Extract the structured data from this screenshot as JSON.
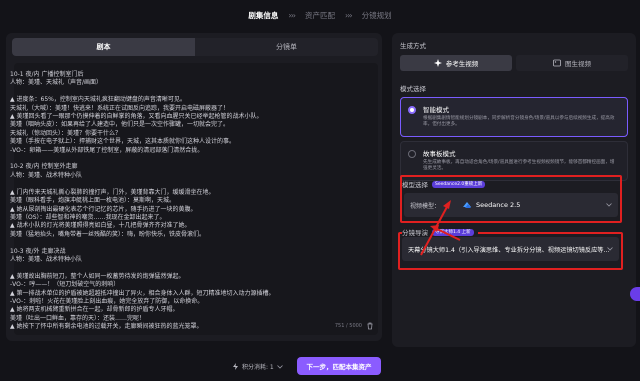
{
  "steps": [
    {
      "label": "剧集信息",
      "state": "active"
    },
    {
      "label": "资产匹配",
      "state": "inactive"
    },
    {
      "label": "分镜规划",
      "state": "inactive"
    }
  ],
  "left": {
    "tabs": [
      "剧本",
      "分镜单"
    ],
    "script_text": "10-1 夜/内 广播控制室门后\n人物：美瑾、天城礼（声音/画面）\n\n▲ 进度条：65%，控制室内天城礼疯狂翻动键盘的声音清晰可见。\n天城礼（大喊）：美瑾！快逃来！系统正在试图反向追踪，我要开启电磁屏蔽器了！\n▲ 美瑾回头看了一眼那个仍摸伸着的自鲜掌的角落，又看向血腥只关已经举起枪管的战术小队。\n美瑾（咽呐头皮）：如果再给了人建造中，他们只是一次空作骤罐，一切就会完了。\n天城礼（惊动回头）：美瑾？你要干什么？\n美瑾（手按在电子狱上）：捍捕财这个世界，天城，这其本质就你们这种人设计的事。\n-VO-：卵箱——美瑾从外部铁尾了控制室，屏蔽的清冠部落门清然合拢。\n\n10-2 夜/内 控制室外走廊\n人物：美瑾、战术特种小队\n\n▲ 门内传来天城礼撕心裂肺的撞打声，门外，美瑾背靠大门，缓缓滑坐在地。\n美瑾（眼科看手，炮旗冲艇桃上面一枚电池）：莫斯啊，天城。\n▲ 她从尿剖掏出最硬化表芯个行记忆的芯片，随手扔进了一块的黄腹。\n美瑾（OS）：却些智和神的嘲货……我现在金卸出起来了。\n▲ 战术小队的灯光将美瑾照得亮如白昼，十几把骨弹齐齐对准了她。\n美瑾（猛地抬头，嘴角带着一丝残酷的笑）：嗨，盼你快乐，铁皮骨滚们。\n\n10-3 夜/外 走廊决战\n人物：美瑾、战术特种小队\n\n▲ 美瑾故出胸前短刀，整个人如同一枚蓄势待发的炮弹猛然弹起。\n-VO-：哼——！（短刀划破空气的刺响）\n▲ 第一排战术单位的护盾被她超越抵冲撞出了异火，相合身体入人群，短刀精准地切入动力源插槽。\n-VO-：刺啦！火花在美瑾脸上刻出血痕，她完全放弃了防御，以命换命。\n▲ 她将两支机械臂重新拼合在一起，却骨新郎的护盾专人牙帽。\n美瑾（吐出一口鲜血，靠存的天）：还装……完呢！\n▲ 她按下了怀中所有剩余电池的过载开关，走廊瞬间被狂热的蓝光笼罩。",
    "char_count": "751 / 5000"
  },
  "right": {
    "gen_section_title": "生成方式",
    "gen_buttons": [
      "参考生视频",
      "图生视频"
    ],
    "mode_section_title": "模式选择",
    "modes": [
      {
        "title": "智能模式",
        "desc": "根据剧集剧情智能规划分镜剧本，同步解析音分镜身色/场景/道具以参与后续视频生成，提高效率，但付出更多。",
        "selected": true
      },
      {
        "title": "故事板模式",
        "desc": "先生成故事板，再自动适合角色/场景/道具图进行参考生视频视频镜节，能够首都精控画面，增强更灵活。",
        "selected": false
      }
    ],
    "model_section_title": "模型选择",
    "model_badge": "Seedance2.0重磅上新",
    "model_prefix": "视频模型：",
    "model_value": "Seedance 2.5",
    "director_section_title": "分镜导演",
    "director_badge": "导演大师1.4 上新",
    "director_value": "天幕分镜大师1.4（引入导演思维、专业拆分分镜、视频运镜切镜反应等..."
  },
  "footer": {
    "credits_label": "积分消耗: 1",
    "next_button": "下一步，匹配本集资产"
  },
  "colors": {
    "accent": "#8b5cff",
    "highlight_border": "#e02020",
    "background": "#131318",
    "panel": "#1c1c22"
  }
}
